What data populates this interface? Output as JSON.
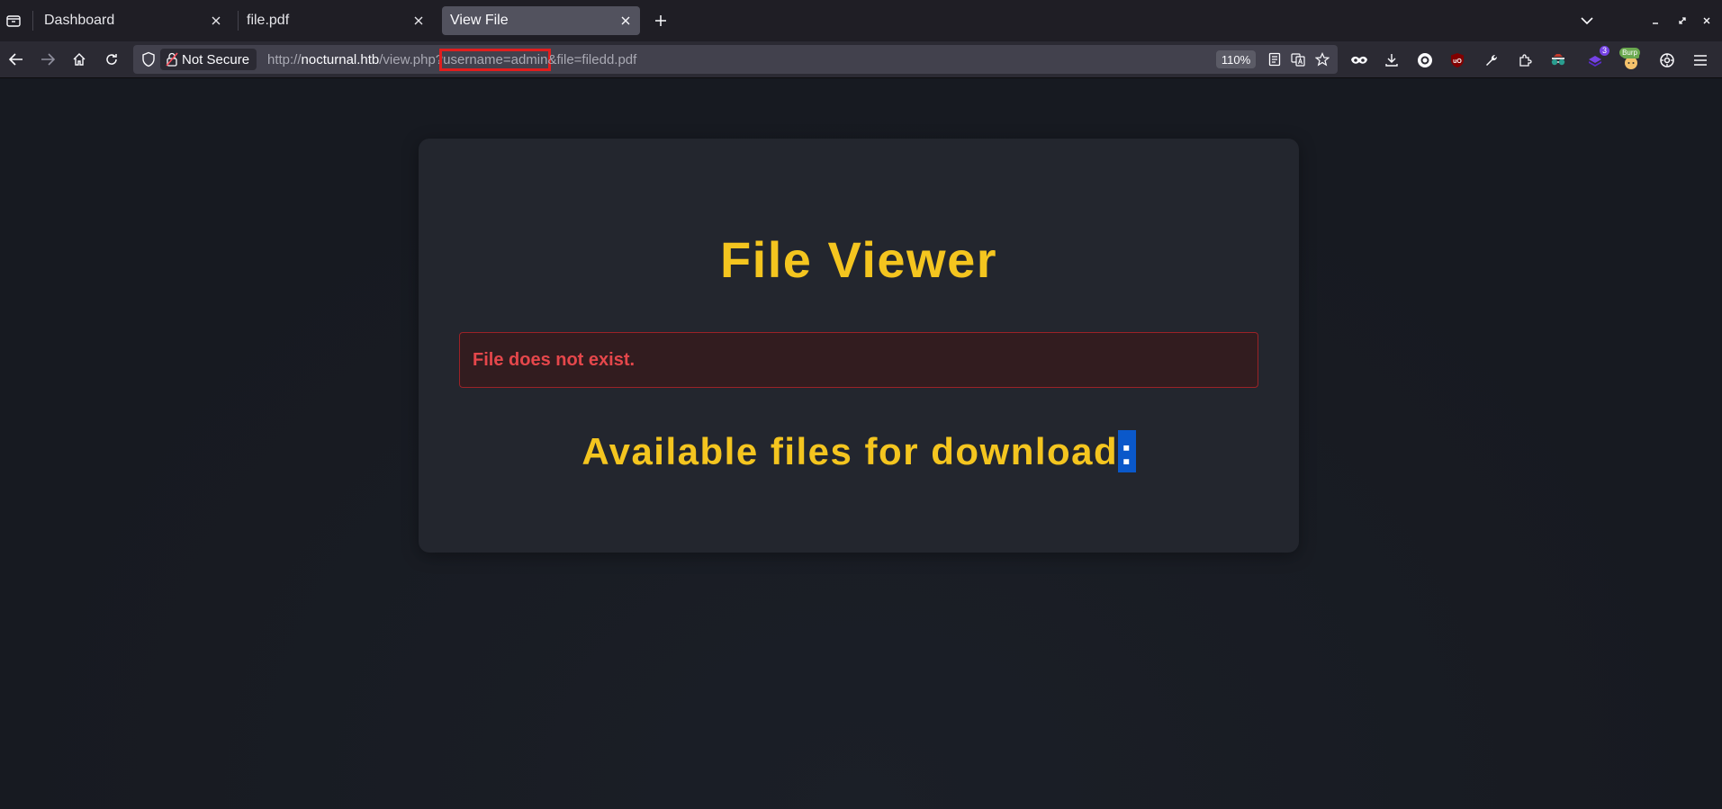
{
  "tabs": [
    {
      "title": "Dashboard",
      "active": false
    },
    {
      "title": "file.pdf",
      "active": false
    },
    {
      "title": "View File",
      "active": true
    }
  ],
  "navbar": {
    "security_label": "Not Secure",
    "url": {
      "scheme": "http://",
      "host": "nocturnal.htb",
      "path": "/view.php?",
      "highlighted_param": "username=admin",
      "rest": "&file=filedd.pdf"
    },
    "zoom": "110%",
    "toolbar_icons": [
      "reader-view-icon",
      "translate-icon",
      "bookmark-star-icon",
      "private-browsing-icon",
      "downloads-icon",
      "extension-o-icon",
      "ublock-icon",
      "wrench-icon",
      "extensions-puzzle-icon",
      "spy-glasses-icon",
      "extension-badge-icon",
      "burp-icon",
      "settings-icon",
      "menu-icon"
    ],
    "extension_badge_count": "3",
    "burp_label": "Burp"
  },
  "page": {
    "title": "File Viewer",
    "error_message": "File does not exist.",
    "available_heading": "Available files for download",
    "available_heading_selected_char": ":"
  },
  "colors": {
    "accent_yellow": "#f4c51f",
    "error_red": "#e5474b",
    "url_highlight": "#e01e1e",
    "selection_blue": "#0a58ca"
  }
}
